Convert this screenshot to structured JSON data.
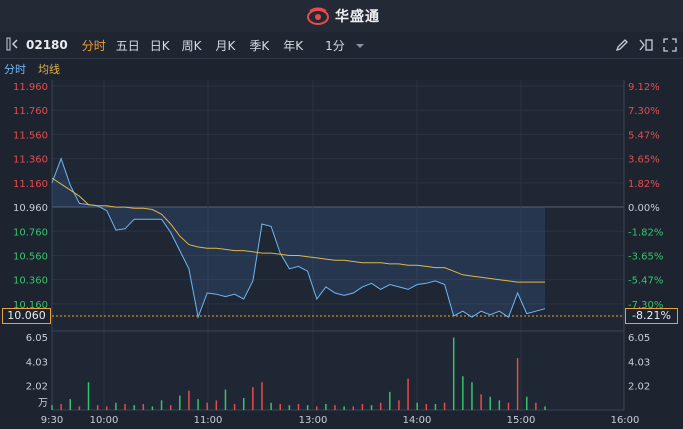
{
  "app": {
    "title": "华盛通"
  },
  "toolbar": {
    "code": "02180",
    "tabs": [
      "分时",
      "五日",
      "日K",
      "周K",
      "月K",
      "季K",
      "年K"
    ],
    "period": "1分"
  },
  "legend": {
    "time_share": "分时",
    "avg_line": "均线"
  },
  "colors": {
    "up": "#e84b4b",
    "down": "#35c46a",
    "price_line": "#6fb7f2",
    "avg_line": "#e0b54a",
    "accent": "#f0a030"
  },
  "chart_data": {
    "type": "line",
    "price_ticks": [
      "11.960",
      "11.760",
      "11.560",
      "11.360",
      "11.160",
      "10.960",
      "10.760",
      "10.560",
      "10.360",
      "10.160"
    ],
    "pct_ticks": [
      "9.12%",
      "7.30%",
      "5.47%",
      "3.65%",
      "1.82%",
      "0.00%",
      "-1.82%",
      "-3.65%",
      "-5.47%",
      "-7.30%"
    ],
    "current_price": "10.060",
    "current_pct": "-8.21%",
    "volume_ticks": [
      "6.05",
      "4.03",
      "2.02"
    ],
    "volume_unit": "万",
    "x_ticks": [
      "9:30",
      "10:00",
      "11:00",
      "13:00",
      "14:00",
      "15:00",
      "16:00"
    ],
    "prev_close": 10.96,
    "price_series": [
      11.16,
      11.36,
      11.14,
      10.99,
      10.98,
      10.97,
      10.93,
      10.77,
      10.78,
      10.86,
      10.86,
      10.86,
      10.86,
      10.75,
      10.6,
      10.45,
      10.05,
      10.25,
      10.24,
      10.22,
      10.24,
      10.2,
      10.35,
      10.82,
      10.8,
      10.58,
      10.45,
      10.47,
      10.43,
      10.2,
      10.3,
      10.25,
      10.23,
      10.25,
      10.3,
      10.33,
      10.28,
      10.32,
      10.3,
      10.28,
      10.32,
      10.33,
      10.35,
      10.32,
      10.06,
      10.1,
      10.05,
      10.1,
      10.07,
      10.1,
      10.05,
      10.25,
      10.08,
      10.1,
      10.12
    ],
    "avg_series": [
      11.2,
      11.15,
      11.1,
      11.05,
      10.98,
      10.97,
      10.97,
      10.96,
      10.96,
      10.95,
      10.95,
      10.94,
      10.9,
      10.82,
      10.72,
      10.65,
      10.63,
      10.62,
      10.62,
      10.61,
      10.6,
      10.6,
      10.59,
      10.58,
      10.58,
      10.57,
      10.56,
      10.56,
      10.55,
      10.54,
      10.53,
      10.52,
      10.52,
      10.51,
      10.5,
      10.5,
      10.5,
      10.49,
      10.49,
      10.48,
      10.48,
      10.47,
      10.46,
      10.46,
      10.43,
      10.4,
      10.39,
      10.38,
      10.37,
      10.36,
      10.35,
      10.34,
      10.34,
      10.34,
      10.34
    ],
    "volumes": [
      0.4,
      0.5,
      0.9,
      0.3,
      2.3,
      0.4,
      0.3,
      0.6,
      0.5,
      0.4,
      0.5,
      0.3,
      0.8,
      0.4,
      1.2,
      1.6,
      0.9,
      0.6,
      0.8,
      1.7,
      0.5,
      1.0,
      1.9,
      2.3,
      0.6,
      0.5,
      0.4,
      0.5,
      0.4,
      0.3,
      0.5,
      0.4,
      0.3,
      0.3,
      0.5,
      0.4,
      0.6,
      1.5,
      0.8,
      2.6,
      0.6,
      0.5,
      0.5,
      0.6,
      6.0,
      2.8,
      2.3,
      1.3,
      1.1,
      0.8,
      0.6,
      4.3,
      1.1,
      0.6,
      0.3
    ],
    "volume_up": [
      false,
      true,
      false,
      true,
      false,
      true,
      true,
      false,
      true,
      false,
      true,
      false,
      false,
      true,
      false,
      true,
      false,
      true,
      true,
      false,
      true,
      false,
      true,
      true,
      false,
      true,
      false,
      true,
      false,
      true,
      false,
      true,
      false,
      true,
      true,
      false,
      true,
      false,
      true,
      true,
      false,
      true,
      false,
      true,
      false,
      false,
      false,
      true,
      false,
      false,
      true,
      true,
      false,
      true,
      false
    ]
  }
}
